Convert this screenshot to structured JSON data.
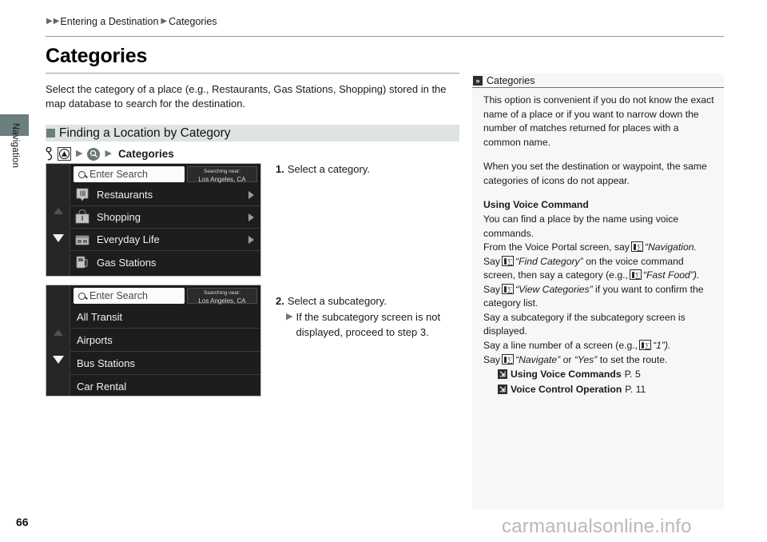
{
  "side_tab": {
    "label": "Navigation"
  },
  "breadcrumb": {
    "parent": "Entering a Destination",
    "current": "Categories"
  },
  "page": {
    "title": "Categories",
    "intro": "Select the category of a place (e.g., Restaurants, Gas Stations, Shopping) stored in the map database to search for the destination.",
    "number": "66",
    "watermark": "carmanualsonline.info"
  },
  "section": {
    "heading": "Finding a Location by Category",
    "icon_path": {
      "finger": "finger-press-icon",
      "home": "map-home-icon",
      "search": "search-circle-icon",
      "label": "Categories"
    }
  },
  "screens": [
    {
      "name": "category-screen",
      "search": {
        "placeholder": "Enter Search",
        "icon": "magnifier-icon"
      },
      "near": {
        "line1": "Searching near:",
        "line2": "Los Angeles, CA"
      },
      "rows": [
        {
          "label": "Restaurants",
          "icon": "restaurant-icon",
          "chevron": true
        },
        {
          "label": "Shopping",
          "icon": "shopping-bag-icon",
          "chevron": true
        },
        {
          "label": "Everyday Life",
          "icon": "storefront-icon",
          "chevron": true
        },
        {
          "label": "Gas Stations",
          "icon": "gas-pump-icon",
          "chevron": false
        }
      ]
    },
    {
      "name": "subcategory-screen",
      "search": {
        "placeholder": "Enter Search",
        "icon": "magnifier-icon"
      },
      "near": {
        "line1": "Searching near:",
        "line2": "Los Angeles, CA"
      },
      "rows": [
        {
          "label": "All Transit",
          "icon": "",
          "chevron": false
        },
        {
          "label": "Airports",
          "icon": "",
          "chevron": false
        },
        {
          "label": "Bus Stations",
          "icon": "",
          "chevron": false
        },
        {
          "label": "Car Rental",
          "icon": "",
          "chevron": false
        }
      ]
    }
  ],
  "steps": [
    {
      "num": "1.",
      "text": "Select a category."
    },
    {
      "num": "2.",
      "text": "Select a subcategory.",
      "sub": "If the subcategory screen is not displayed, proceed to step 3."
    }
  ],
  "sidebar": {
    "title": "Categories",
    "para1": "This option is convenient if you do not know the exact name of a place or if you want to narrow down the number of matches returned for places with a common name.",
    "para2": "When you set the destination or waypoint, the same categories of icons do not appear.",
    "voice_heading": "Using Voice Command",
    "voice_line1": "You can find a place by the name using voice commands.",
    "v_from": "From the Voice Portal screen, say",
    "v_nav": "“Navigation.",
    "v_say1": "Say",
    "v_find": "“Find Category”",
    "v_on": "on the voice command screen, then say a category (e.g.,",
    "v_fast": "“Fast Food”).",
    "v_say2": "Say",
    "v_view": "“View Categories”",
    "v_confirm": "if you want to confirm the category list.",
    "v_sub": "Say a subcategory if the subcategory screen is displayed.",
    "v_line": "Say a line number of a screen (e.g.,",
    "v_one": "“1”).",
    "v_say3": "Say",
    "v_navigate": "“Navigate”",
    "v_or": "or",
    "v_yes": "“Yes”",
    "v_route": "to set the route.",
    "xrefs": [
      {
        "label": "Using Voice Commands",
        "page": "P. 5"
      },
      {
        "label": "Voice Control Operation",
        "page": "P. 11"
      }
    ]
  },
  "colors": {
    "tab": "#6c7e7e",
    "section_band": "#dfe4e2",
    "screen_bg": "#1d1d1d",
    "sidebar_bg": "#f7f7f5",
    "watermark": "#b9b9b9"
  }
}
